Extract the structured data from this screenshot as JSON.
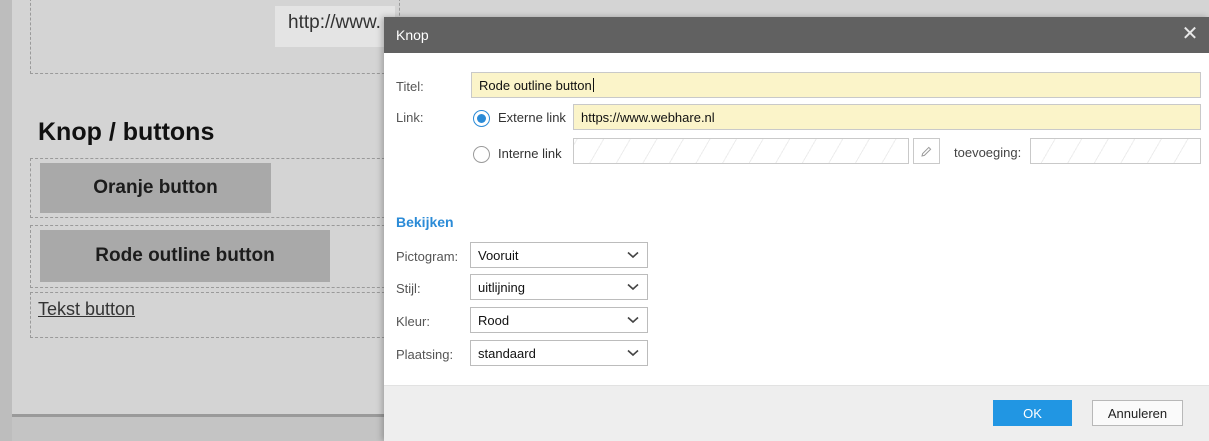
{
  "background": {
    "url_text": "http://www.",
    "heading": "Knop / buttons",
    "buttons": [
      "Oranje button",
      "Rode outline button"
    ],
    "text_button": "Tekst button"
  },
  "dialog": {
    "title": "Knop",
    "close_icon": "close-icon",
    "fields": {
      "title_label": "Titel:",
      "title_value": "Rode outline button",
      "link_label": "Link:",
      "external_label": "Externe link",
      "external_value": "https://www.webhare.nl",
      "internal_label": "Interne link",
      "internal_value": "",
      "addition_label": "toevoeging:",
      "addition_value": "",
      "link_type_selected": "Externe link"
    },
    "view_section": {
      "title": "Bekijken",
      "rows": [
        {
          "label": "Pictogram:",
          "value": "Vooruit"
        },
        {
          "label": "Stijl:",
          "value": "uitlijning"
        },
        {
          "label": "Kleur:",
          "value": "Rood"
        },
        {
          "label": "Plaatsing:",
          "value": "standaard"
        }
      ]
    },
    "footer": {
      "ok_label": "OK",
      "cancel_label": "Annuleren"
    },
    "colors": {
      "accent": "#2196e3",
      "titlebar": "#616161",
      "highlight_field": "#fbf4c9"
    }
  }
}
